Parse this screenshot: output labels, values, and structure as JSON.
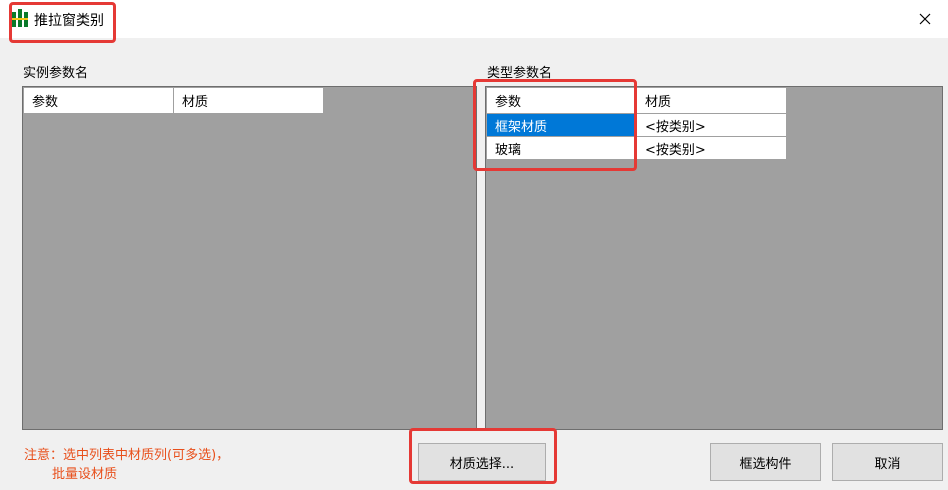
{
  "window": {
    "title": "推拉窗类别"
  },
  "instance_panel": {
    "label": "实例参数名",
    "columns": [
      "参数",
      "材质"
    ],
    "rows": []
  },
  "type_panel": {
    "label": "类型参数名",
    "columns": [
      "参数",
      "材质"
    ],
    "rows": [
      {
        "param": "框架材质",
        "material": "<按类别>"
      },
      {
        "param": "玻璃",
        "material": "<按类别>"
      }
    ]
  },
  "note": {
    "line1": "注意：选中列表中材质列(可多选)，",
    "line2": "批量设材质"
  },
  "buttons": {
    "select_material": "材质选择...",
    "select_components": "框选构件",
    "cancel": "取消"
  },
  "colors": {
    "highlight": "#e53935",
    "note": "#e8501c",
    "selection": "#0078d7",
    "grid_background": "#a0a0a0"
  }
}
